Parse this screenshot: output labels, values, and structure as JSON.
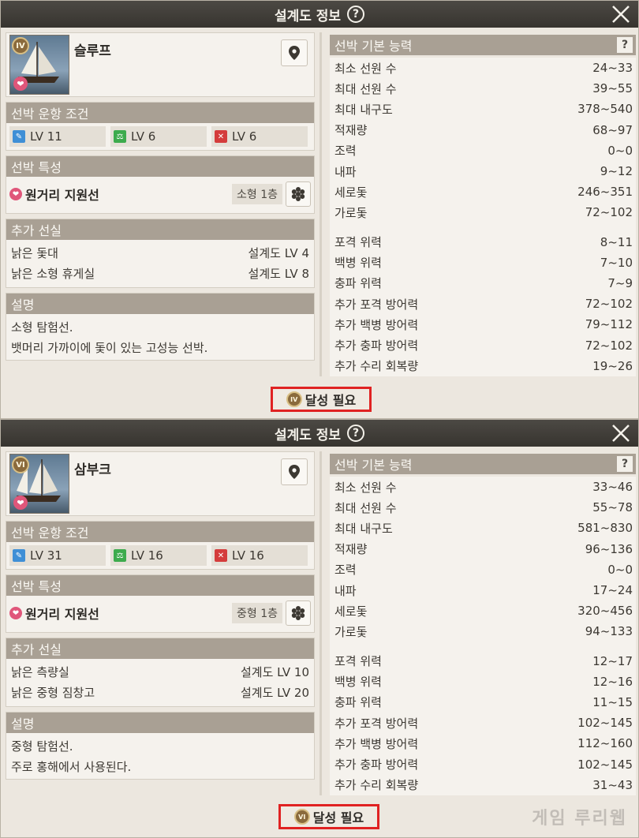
{
  "panels": [
    {
      "title": "설계도 정보",
      "help": "?",
      "ship": {
        "name": "슬루프",
        "grade": "IV"
      },
      "conditions": {
        "header": "선박 운항 조건",
        "levels": [
          {
            "icon": "adventure-icon",
            "label": "LV 11",
            "color": "#3f8fd6"
          },
          {
            "icon": "trade-icon",
            "label": "LV 6",
            "color": "#3dab4d"
          },
          {
            "icon": "battle-icon",
            "label": "LV 6",
            "color": "#d43c3c"
          }
        ]
      },
      "trait": {
        "header": "선박 특성",
        "name": "원거리 지원선",
        "size": "소형 1층"
      },
      "cabins": {
        "header": "추가 선실",
        "items": [
          {
            "name": "낡은 돛대",
            "req": "설계도 LV 4"
          },
          {
            "name": "낡은 소형 휴게실",
            "req": "설계도 LV 8"
          }
        ]
      },
      "description": {
        "header": "설명",
        "lines": [
          "소형 탐험선.",
          "뱃머리 가까이에 돛이 있는 고성능 선박."
        ]
      },
      "stats": {
        "header": "선박 기본 능력",
        "help": "?",
        "group1": [
          {
            "name": "최소 선원 수",
            "value": "24~33"
          },
          {
            "name": "최대 선원 수",
            "value": "39~55"
          },
          {
            "name": "최대 내구도",
            "value": "378~540"
          },
          {
            "name": "적재량",
            "value": "68~97"
          },
          {
            "name": "조력",
            "value": "0~0"
          },
          {
            "name": "내파",
            "value": "9~12"
          },
          {
            "name": "세로돛",
            "value": "246~351"
          },
          {
            "name": "가로돛",
            "value": "72~102"
          }
        ],
        "group2": [
          {
            "name": "포격 위력",
            "value": "8~11"
          },
          {
            "name": "백병 위력",
            "value": "7~10"
          },
          {
            "name": "충파 위력",
            "value": "7~9"
          },
          {
            "name": "추가 포격 방어력",
            "value": "72~102"
          },
          {
            "name": "추가 백병 방어력",
            "value": "79~112"
          },
          {
            "name": "추가 충파 방어력",
            "value": "72~102"
          },
          {
            "name": "추가 수리 회복량",
            "value": "19~26"
          }
        ]
      },
      "need": {
        "grade": "IV",
        "label": "달성 필요"
      }
    },
    {
      "title": "설계도 정보",
      "help": "?",
      "ship": {
        "name": "삼부크",
        "grade": "VI"
      },
      "conditions": {
        "header": "선박 운항 조건",
        "levels": [
          {
            "icon": "adventure-icon",
            "label": "LV 31",
            "color": "#3f8fd6"
          },
          {
            "icon": "trade-icon",
            "label": "LV 16",
            "color": "#3dab4d"
          },
          {
            "icon": "battle-icon",
            "label": "LV 16",
            "color": "#d43c3c"
          }
        ]
      },
      "trait": {
        "header": "선박 특성",
        "name": "원거리 지원선",
        "size": "중형 1층"
      },
      "cabins": {
        "header": "추가 선실",
        "items": [
          {
            "name": "낡은 측량실",
            "req": "설계도 LV 10"
          },
          {
            "name": "낡은 중형 짐창고",
            "req": "설계도 LV 20"
          }
        ]
      },
      "description": {
        "header": "설명",
        "lines": [
          "중형 탐험선.",
          "주로 홍해에서 사용된다."
        ]
      },
      "stats": {
        "header": "선박 기본 능력",
        "help": "?",
        "group1": [
          {
            "name": "최소 선원 수",
            "value": "33~46"
          },
          {
            "name": "최대 선원 수",
            "value": "55~78"
          },
          {
            "name": "최대 내구도",
            "value": "581~830"
          },
          {
            "name": "적재량",
            "value": "96~136"
          },
          {
            "name": "조력",
            "value": "0~0"
          },
          {
            "name": "내파",
            "value": "17~24"
          },
          {
            "name": "세로돛",
            "value": "320~456"
          },
          {
            "name": "가로돛",
            "value": "94~133"
          }
        ],
        "group2": [
          {
            "name": "포격 위력",
            "value": "12~17"
          },
          {
            "name": "백병 위력",
            "value": "12~16"
          },
          {
            "name": "충파 위력",
            "value": "11~15"
          },
          {
            "name": "추가 포격 방어력",
            "value": "102~145"
          },
          {
            "name": "추가 백병 방어력",
            "value": "112~160"
          },
          {
            "name": "추가 충파 방어력",
            "value": "102~145"
          },
          {
            "name": "추가 수리 회복량",
            "value": "31~43"
          }
        ]
      },
      "need": {
        "grade": "VI",
        "label": "달성 필요"
      }
    }
  ],
  "watermark": "게임 루리웹"
}
